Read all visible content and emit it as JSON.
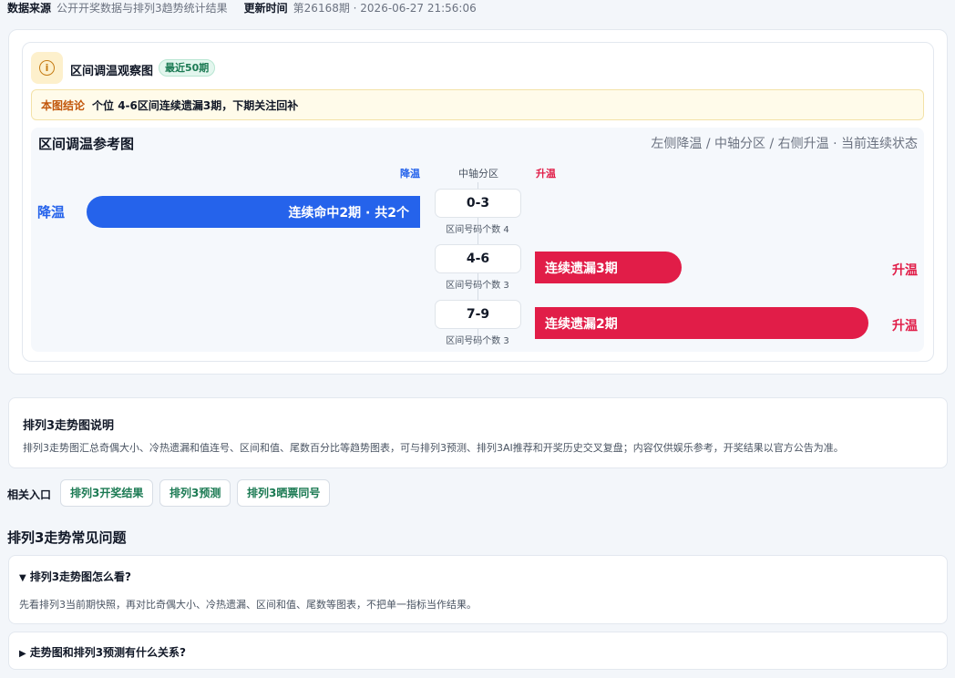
{
  "meta": {
    "source_label": "数据来源",
    "source_value": "公开开奖数据与排列3趋势统计结果",
    "update_label": "更新时间",
    "update_value": "第26168期 · 2026-06-27 21:56:06"
  },
  "panel": {
    "icon": "info-icon",
    "title": "区间调温观察图",
    "badge": "最近50期",
    "conclusion_label": "本图结论",
    "conclusion_text": "个位 4-6区间连续遗漏3期，下期关注回补"
  },
  "chart_data": {
    "type": "bar",
    "title": "区间调温参考图",
    "subtitle": "左侧降温 / 中轴分区 / 右侧升温 · 当前连续状态",
    "header_cool": "降温",
    "header_axis": "中轴分区",
    "header_warm": "升温",
    "rows": [
      {
        "zone": "0-3",
        "count_text": "区间号码个数 4",
        "direction": "cool",
        "periods": 2,
        "bar_text": "连续命中2期 · 共2个",
        "side_label": "降温"
      },
      {
        "zone": "4-6",
        "count_text": "区间号码个数 3",
        "direction": "warm",
        "periods": 3,
        "bar_text": "连续遗漏3期",
        "side_label": "升温"
      },
      {
        "zone": "7-9",
        "count_text": "区间号码个数 3",
        "direction": "warm",
        "periods": 2,
        "bar_text": "连续遗漏2期",
        "side_label": "升温"
      }
    ],
    "colors": {
      "cool": "#2563eb",
      "warm": "#e11d48"
    }
  },
  "explain": {
    "title": "排列3走势图说明",
    "text": "排列3走势图汇总奇偶大小、冷热遗漏和值连号、区间和值、尾数百分比等趋势图表，可与排列3预测、排列3AI推荐和开奖历史交叉复盘；内容仅供娱乐参考，开奖结果以官方公告为准。"
  },
  "related": {
    "label": "相关入口",
    "links": [
      "排列3开奖结果",
      "排列3预测",
      "排列3晒票同号"
    ]
  },
  "faq": {
    "heading": "排列3走势常见问题",
    "items": [
      {
        "marker": "▼",
        "question": "排列3走势图怎么看?",
        "answer": "先看排列3当前期快照，再对比奇偶大小、冷热遗漏、区间和值、尾数等图表，不把单一指标当作结果。"
      },
      {
        "marker": "▶",
        "question": "走势图和排列3预测有什么关系?"
      }
    ]
  }
}
